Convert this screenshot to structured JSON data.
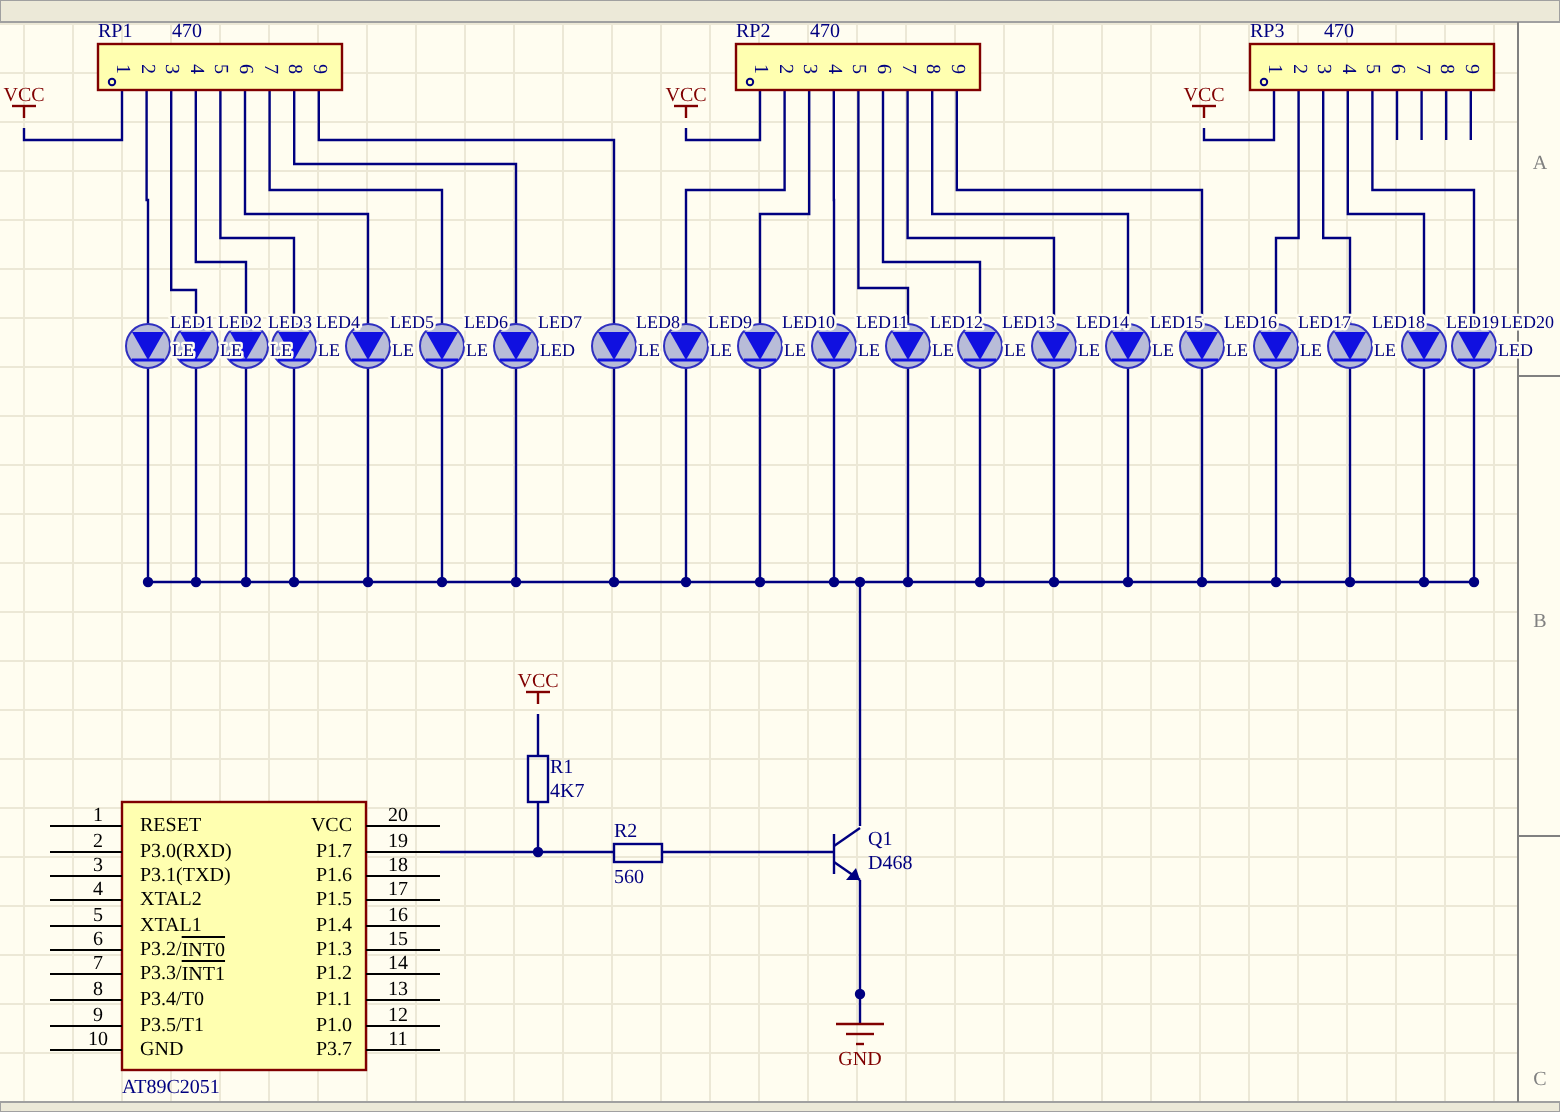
{
  "zones": [
    "A",
    "B",
    "C"
  ],
  "resistor_networks": [
    {
      "designator": "RP1",
      "value": "470",
      "power": "VCC",
      "pins": [
        "1",
        "2",
        "3",
        "4",
        "5",
        "6",
        "7",
        "8",
        "9"
      ]
    },
    {
      "designator": "RP2",
      "value": "470",
      "power": "VCC",
      "pins": [
        "1",
        "2",
        "3",
        "4",
        "5",
        "6",
        "7",
        "8",
        "9"
      ]
    },
    {
      "designator": "RP3",
      "value": "470",
      "power": "VCC",
      "pins": [
        "1",
        "2",
        "3",
        "4",
        "5",
        "6",
        "7",
        "8",
        "9"
      ]
    }
  ],
  "leds": [
    {
      "designator": "LED1",
      "comment": "LE"
    },
    {
      "designator": "LED2",
      "comment": "LE"
    },
    {
      "designator": "LED3",
      "comment": "LE"
    },
    {
      "designator": "LED4",
      "comment": "LE"
    },
    {
      "designator": "LED5",
      "comment": "LE"
    },
    {
      "designator": "LED6",
      "comment": "LE"
    },
    {
      "designator": "LED7",
      "comment": "LED"
    },
    {
      "designator": "LED8",
      "comment": "LE"
    },
    {
      "designator": "LED9",
      "comment": "LE"
    },
    {
      "designator": "LED10",
      "comment": "LE"
    },
    {
      "designator": "LED11",
      "comment": "LE"
    },
    {
      "designator": "LED12",
      "comment": "LE"
    },
    {
      "designator": "LED13",
      "comment": "LE"
    },
    {
      "designator": "LED14",
      "comment": "LE"
    },
    {
      "designator": "LED15",
      "comment": "LE"
    },
    {
      "designator": "LED16",
      "comment": "LE"
    },
    {
      "designator": "LED17",
      "comment": "LE"
    },
    {
      "designator": "LED18",
      "comment": "LE"
    },
    {
      "designator": "LED19"
    },
    {
      "designator": "LED20",
      "comment": "LED"
    }
  ],
  "resistors": [
    {
      "designator": "R1",
      "value": "4K7",
      "power": "VCC"
    },
    {
      "designator": "R2",
      "value": "560"
    }
  ],
  "transistor": {
    "designator": "Q1",
    "value": "D468"
  },
  "ground": {
    "label": "GND"
  },
  "chip": {
    "name": "AT89C2051",
    "left_pins": [
      {
        "number": "1",
        "label": "RESET"
      },
      {
        "number": "2",
        "label": "P3.0(RXD)"
      },
      {
        "number": "3",
        "label": "P3.1(TXD)"
      },
      {
        "number": "4",
        "label": "XTAL2"
      },
      {
        "number": "5",
        "label": "XTAL1"
      },
      {
        "number": "6",
        "label": "P3.2/",
        "overbar_label": "INT0"
      },
      {
        "number": "7",
        "label": "P3.3/",
        "overbar_label": "INT1"
      },
      {
        "number": "8",
        "label": "P3.4/T0"
      },
      {
        "number": "9",
        "label": "P3.5/T1"
      },
      {
        "number": "10",
        "label": "GND"
      }
    ],
    "right_pins": [
      {
        "number": "20",
        "label": "VCC"
      },
      {
        "number": "19",
        "label": "P1.7"
      },
      {
        "number": "18",
        "label": "P1.6"
      },
      {
        "number": "17",
        "label": "P1.5"
      },
      {
        "number": "16",
        "label": "P1.4"
      },
      {
        "number": "15",
        "label": "P1.3"
      },
      {
        "number": "14",
        "label": "P1.2"
      },
      {
        "number": "13",
        "label": "P1.1"
      },
      {
        "number": "12",
        "label": "P1.0"
      },
      {
        "number": "11",
        "label": "P3.7"
      }
    ]
  }
}
